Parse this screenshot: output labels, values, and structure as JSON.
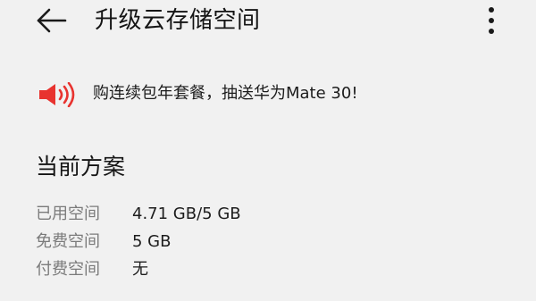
{
  "header": {
    "back_icon": "arrow-left-icon",
    "title": "升级云存储空间",
    "more_icon": "more-vertical-icon"
  },
  "promo": {
    "icon": "speaker-icon",
    "icon_color": "#e8332f",
    "text": "购连续包年套餐，抽送华为Mate 30!"
  },
  "current_plan": {
    "title": "当前方案",
    "rows": [
      {
        "label": "已用空间",
        "value": "4.71 GB/5 GB"
      },
      {
        "label": "免费空间",
        "value": "5 GB"
      },
      {
        "label": "付费空间",
        "value": "无"
      }
    ]
  },
  "colors": {
    "background": "#f1f1f1",
    "label_gray": "#7b7b7b",
    "text_dark": "#1b1b1b"
  }
}
